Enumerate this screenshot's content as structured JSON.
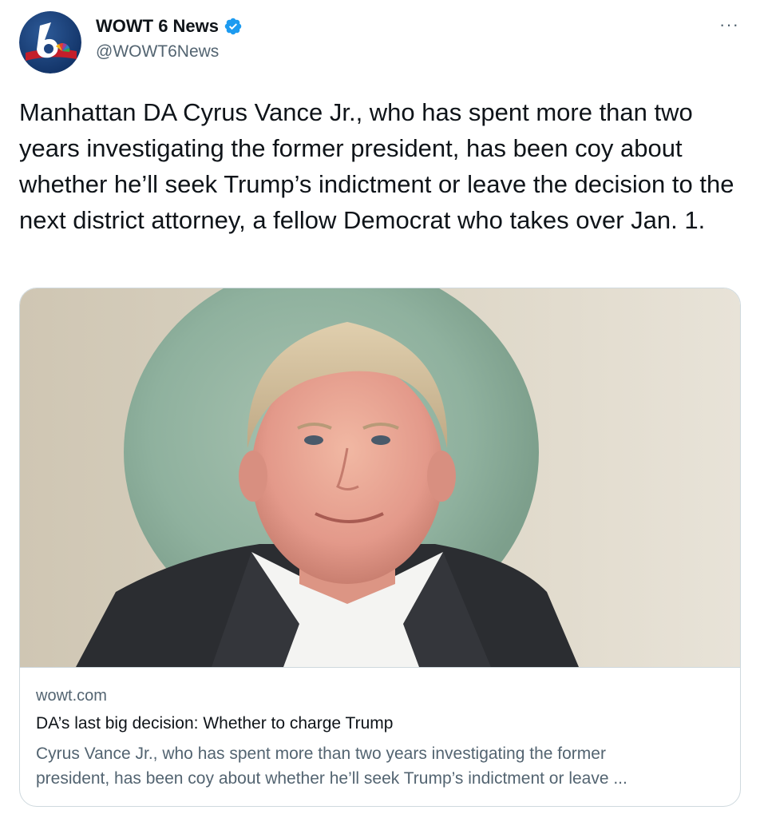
{
  "author": {
    "display_name": "WOWT 6 News",
    "handle": "@WOWT6News",
    "avatar_icon": "wowt-6-nbc-logo-icon",
    "verified_icon": "verified-badge-icon",
    "verified_color": "#1d9bf0"
  },
  "more_icon": "more-horizontal-icon",
  "more_label": "···",
  "tweet": {
    "text": "Manhattan DA Cyrus Vance Jr., who has spent more than two years investigating the former president, has been coy about whether he’ll seek Trump’s indictment or leave the decision to the next district attorney, a fellow Democrat who takes over Jan. 1."
  },
  "card": {
    "domain": "wowt.com",
    "title": "DA’s last big decision: Whether to charge Trump",
    "description_line1": "Cyrus Vance Jr., who has spent more than two years investigating the former",
    "description_line2": "president, has been coy about whether he’ll seek Trump’s indictment or leave ..."
  },
  "colors": {
    "text_primary": "#0f1419",
    "text_secondary": "#536471",
    "border": "#cfd9de",
    "accent": "#1d9bf0"
  }
}
